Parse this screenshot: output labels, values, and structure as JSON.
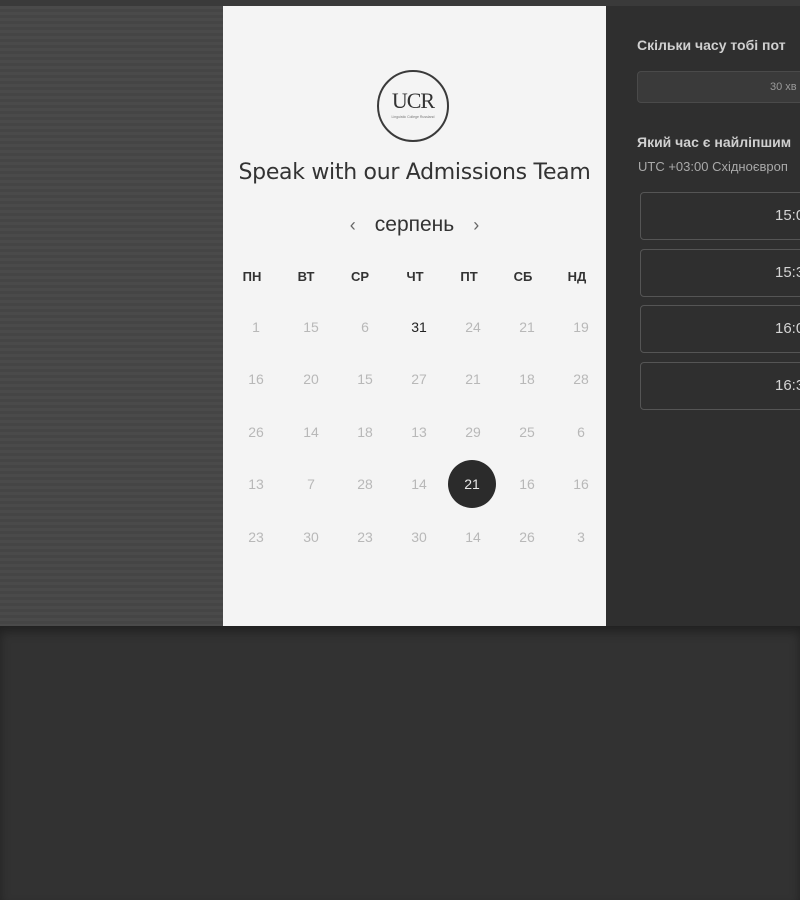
{
  "header": {
    "title": "Speak with our Admissions Team"
  },
  "logo": {
    "text": "UCR",
    "subtitle": "Linguistic College Russland"
  },
  "calendar": {
    "month": "серпень",
    "prev_icon": "chevron-left-icon",
    "next_icon": "chevron-right-icon",
    "weekdays": [
      "ПН",
      "ВТ",
      "СР",
      "ЧТ",
      "ПТ",
      "СБ",
      "НД"
    ],
    "weeks": [
      [
        "1",
        "15",
        "6",
        "31",
        "24",
        "21",
        "19"
      ],
      [
        "16",
        "20",
        "15",
        "27",
        "21",
        "18",
        "28"
      ],
      [
        "26",
        "14",
        "18",
        "13",
        "29",
        "25",
        "6"
      ],
      [
        "13",
        "7",
        "28",
        "14",
        "21",
        "16",
        "16"
      ],
      [
        "23",
        "30",
        "23",
        "30",
        "14",
        "26",
        "3"
      ]
    ],
    "active_day": "31",
    "selected_day": "21"
  },
  "side": {
    "duration_question": "Скільки часу тобі пот",
    "duration_value": "30 хв",
    "time_question": "Який час є найліпшим",
    "timezone": "UTC +03:00 Східноєвроп",
    "slots": [
      "15:0",
      "15:3",
      "16:0",
      "16:3"
    ]
  },
  "colors": {
    "selected_bg": "#2b2b2b",
    "panel_bg": "#f4f4f4",
    "sidebar_bg": "#2f2f2f"
  }
}
